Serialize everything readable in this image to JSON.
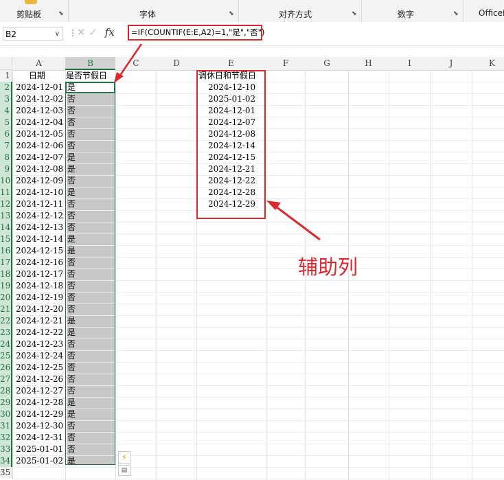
{
  "ribbon": {
    "groups": [
      "剪贴板",
      "字体",
      "对齐方式",
      "数字",
      "OfficeP"
    ]
  },
  "formula_bar": {
    "name_box": "B2",
    "formula": "=IF(COUNTIF(E:E,A2)=1,\"是\",\"否\")"
  },
  "columns": [
    "A",
    "B",
    "C",
    "D",
    "E",
    "F",
    "G",
    "H",
    "I",
    "J",
    "K"
  ],
  "rows": [
    "1",
    "2",
    "3",
    "4",
    "5",
    "6",
    "7",
    "8",
    "9",
    "10",
    "11",
    "12",
    "13",
    "14",
    "15",
    "16",
    "17",
    "18",
    "19",
    "20",
    "21",
    "22",
    "23",
    "24",
    "25",
    "26",
    "27",
    "28",
    "29",
    "30",
    "31",
    "32",
    "33",
    "34",
    "35"
  ],
  "headers": {
    "date": "日期",
    "is_holiday": "是否节假日",
    "adjusted": "调休日和节假日"
  },
  "dates": [
    "2024-12-01",
    "2024-12-02",
    "2024-12-03",
    "2024-12-04",
    "2024-12-05",
    "2024-12-06",
    "2024-12-07",
    "2024-12-08",
    "2024-12-09",
    "2024-12-10",
    "2024-12-11",
    "2024-12-12",
    "2024-12-13",
    "2024-12-14",
    "2024-12-15",
    "2024-12-16",
    "2024-12-17",
    "2024-12-18",
    "2024-12-19",
    "2024-12-20",
    "2024-12-21",
    "2024-12-22",
    "2024-12-23",
    "2024-12-24",
    "2024-12-25",
    "2024-12-26",
    "2024-12-27",
    "2024-12-28",
    "2024-12-29",
    "2024-12-30",
    "2024-12-31",
    "2025-01-01",
    "2025-01-02"
  ],
  "flags": [
    "是",
    "否",
    "否",
    "否",
    "否",
    "否",
    "是",
    "是",
    "否",
    "是",
    "否",
    "否",
    "否",
    "是",
    "是",
    "否",
    "否",
    "否",
    "否",
    "否",
    "是",
    "是",
    "否",
    "否",
    "否",
    "否",
    "否",
    "是",
    "是",
    "否",
    "否",
    "否",
    "是"
  ],
  "helper_dates": [
    "2024-12-10",
    "2025-01-02",
    "2024-12-01",
    "2024-12-07",
    "2024-12-08",
    "2024-12-14",
    "2024-12-15",
    "2024-12-21",
    "2024-12-22",
    "2024-12-28",
    "2024-12-29"
  ],
  "annotation": "辅助列",
  "colors": {
    "accent_red": "#d9282e",
    "selection_green": "#217346",
    "selection_gray": "#c8c8c8"
  }
}
